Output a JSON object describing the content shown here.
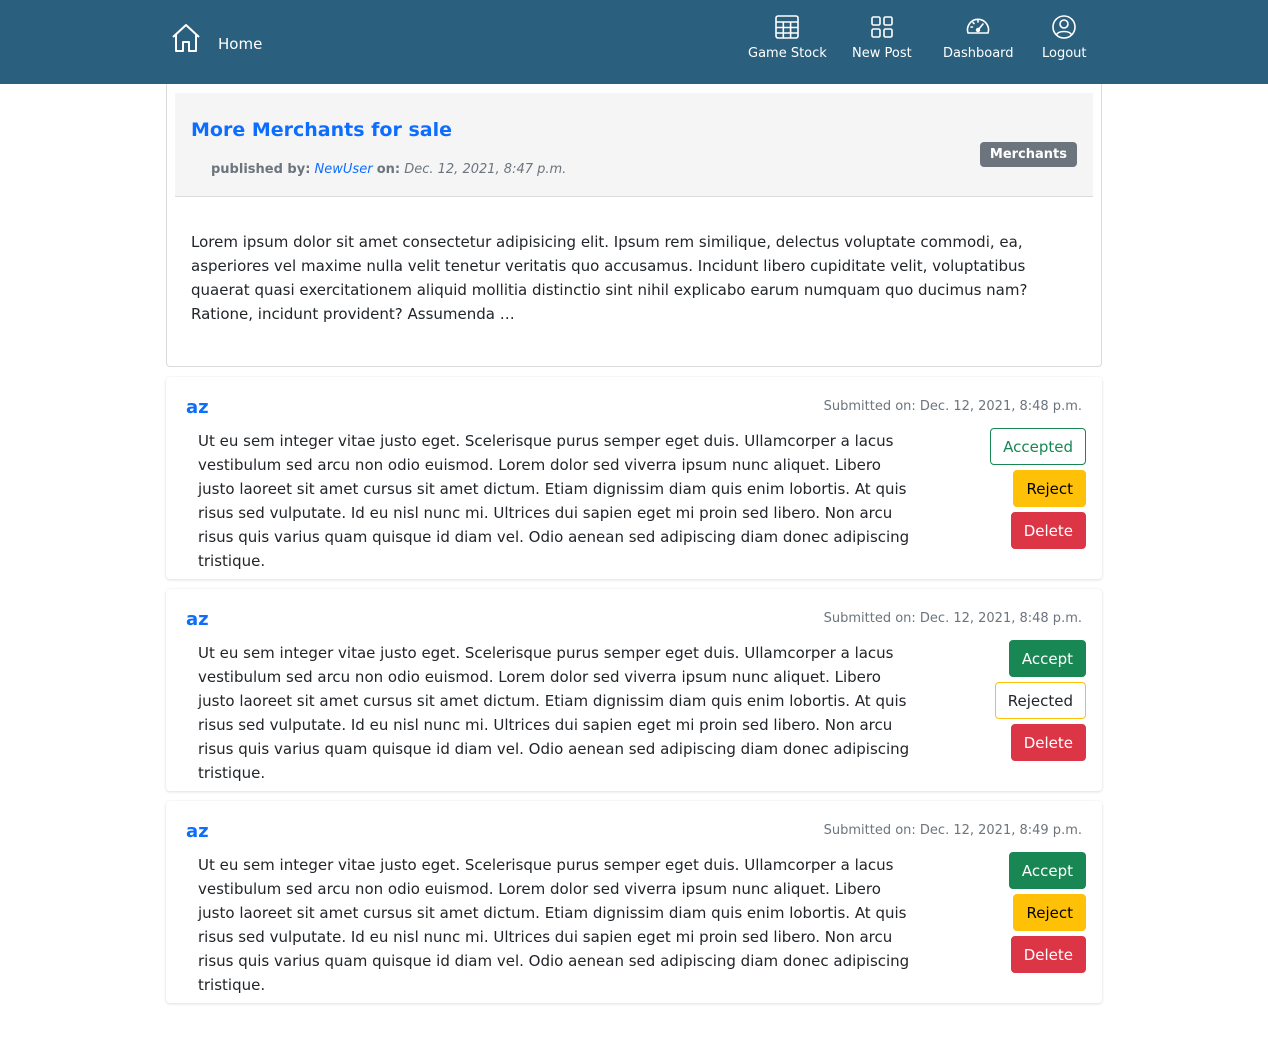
{
  "navbar": {
    "home_label": "Home",
    "items": [
      {
        "label": "Game Stock",
        "icon": "table-grid-icon"
      },
      {
        "label": "New Post",
        "icon": "grid-squares-icon"
      },
      {
        "label": "Dashboard",
        "icon": "speedometer-icon"
      },
      {
        "label": "Logout",
        "icon": "user-circle-icon"
      }
    ],
    "background": "#2b5f7e"
  },
  "post": {
    "title": "More Merchants for sale",
    "published_by_label": "published by:",
    "author": "NewUser",
    "on_label": "on:",
    "date": "Dec. 12, 2021, 8:47 p.m.",
    "category": "Merchants",
    "body": "Lorem ipsum dolor sit amet consectetur adipisicing elit. Ipsum rem similique, delectus voluptate commodi, ea, asperiores vel maxime nulla velit tenetur veritatis quo accusamus. Incidunt libero cupiditate velit, voluptatibus quaerat quasi exercitationem aliquid mollitia distinctio sint nihil explicabo earum numquam quo ducimus nam? Ratione, incidunt provident? Assumenda …"
  },
  "comments": [
    {
      "author": "az",
      "submitted": "Submitted on: Dec. 12, 2021, 8:48 p.m.",
      "text": "Ut eu sem integer vitae justo eget. Scelerisque purus semper eget duis. Ullamcorper a lacus vestibulum sed arcu non odio euismod. Lorem dolor sed viverra ipsum nunc aliquet. Libero justo laoreet sit amet cursus sit amet dictum. Etiam dignissim diam quis enim lobortis. At quis risus sed vulputate. Id eu nisl nunc mi. Ultrices dui sapien eget mi proin sed libero. Non arcu risus quis varius quam quisque id diam vel. Odio aenean sed adipiscing diam donec adipiscing tristique.",
      "accept_label": "Accepted",
      "reject_label": "Reject",
      "delete_label": "Delete"
    },
    {
      "author": "az",
      "submitted": "Submitted on: Dec. 12, 2021, 8:48 p.m.",
      "text": "Ut eu sem integer vitae justo eget. Scelerisque purus semper eget duis. Ullamcorper a lacus vestibulum sed arcu non odio euismod. Lorem dolor sed viverra ipsum nunc aliquet. Libero justo laoreet sit amet cursus sit amet dictum. Etiam dignissim diam quis enim lobortis. At quis risus sed vulputate. Id eu nisl nunc mi. Ultrices dui sapien eget mi proin sed libero. Non arcu risus quis varius quam quisque id diam vel. Odio aenean sed adipiscing diam donec adipiscing tristique.",
      "accept_label": "Accept",
      "reject_label": "Rejected",
      "delete_label": "Delete"
    },
    {
      "author": "az",
      "submitted": "Submitted on: Dec. 12, 2021, 8:49 p.m.",
      "text": "Ut eu sem integer vitae justo eget. Scelerisque purus semper eget duis. Ullamcorper a lacus vestibulum sed arcu non odio euismod. Lorem dolor sed viverra ipsum nunc aliquet. Libero justo laoreet sit amet cursus sit amet dictum. Etiam dignissim diam quis enim lobortis. At quis risus sed vulputate. Id eu nisl nunc mi. Ultrices dui sapien eget mi proin sed libero. Non arcu risus quis varius quam quisque id diam vel. Odio aenean sed adipiscing diam donec adipiscing tristique.",
      "accept_label": "Accept",
      "reject_label": "Reject",
      "delete_label": "Delete"
    }
  ],
  "colors": {
    "link": "#0d6efd",
    "success": "#198754",
    "warning": "#ffc107",
    "danger": "#dc3545",
    "secondary": "#6c757d"
  }
}
